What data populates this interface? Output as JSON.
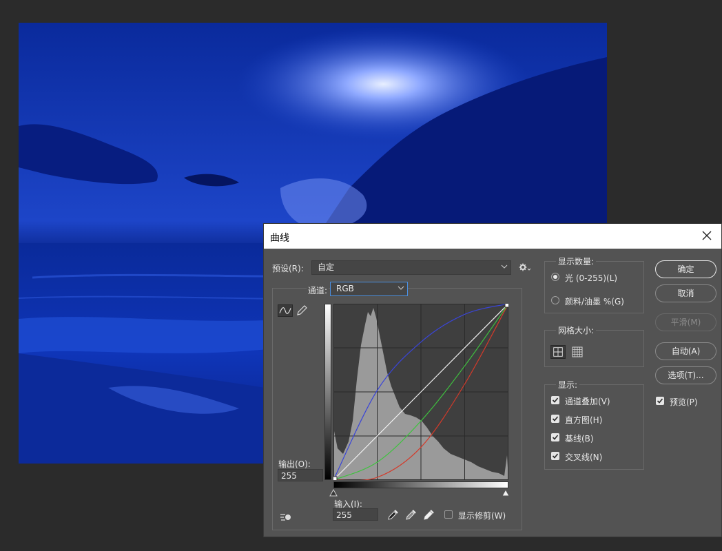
{
  "dialog": {
    "title": "曲线",
    "preset_label": "预设(R):",
    "preset_value": "自定",
    "channel_label": "通道:",
    "channel_value": "RGB",
    "output_label": "输出(O):",
    "output_value": "255",
    "input_label": "输入(I):",
    "input_value": "255",
    "show_clipping_label": "显示修剪(W)",
    "show_amount_title": "显示数量:",
    "light_option": "光 (0-255)(L)",
    "pigment_option": "颜料/油墨 %(G)",
    "grid_size_title": "网格大小:",
    "show_title": "显示:",
    "show_options": [
      {
        "label": "通道叠加(V)",
        "checked": true
      },
      {
        "label": "直方图(H)",
        "checked": true
      },
      {
        "label": "基线(B)",
        "checked": true
      },
      {
        "label": "交叉线(N)",
        "checked": true
      }
    ],
    "buttons": {
      "ok": "确定",
      "cancel": "取消",
      "smooth": "平滑(M)",
      "auto": "自动(A)",
      "options": "选项(T)..."
    },
    "preview_label": "预览(P)",
    "preview_checked": true
  },
  "curves": {
    "rgb_points": [
      [
        0,
        0
      ],
      [
        255,
        255
      ]
    ],
    "red_points": [
      [
        0,
        0
      ],
      [
        64,
        4
      ],
      [
        128,
        48
      ],
      [
        192,
        140
      ],
      [
        255,
        255
      ]
    ],
    "green_points": [
      [
        0,
        0
      ],
      [
        64,
        26
      ],
      [
        128,
        86
      ],
      [
        192,
        166
      ],
      [
        255,
        255
      ]
    ],
    "blue_points": [
      [
        0,
        0
      ],
      [
        64,
        130
      ],
      [
        128,
        200
      ],
      [
        192,
        240
      ],
      [
        255,
        255
      ]
    ]
  },
  "colors": {
    "dialog_bg": "#535353",
    "accent_blue": "#4b8fe0",
    "image_tint": "#0b2a9e"
  }
}
